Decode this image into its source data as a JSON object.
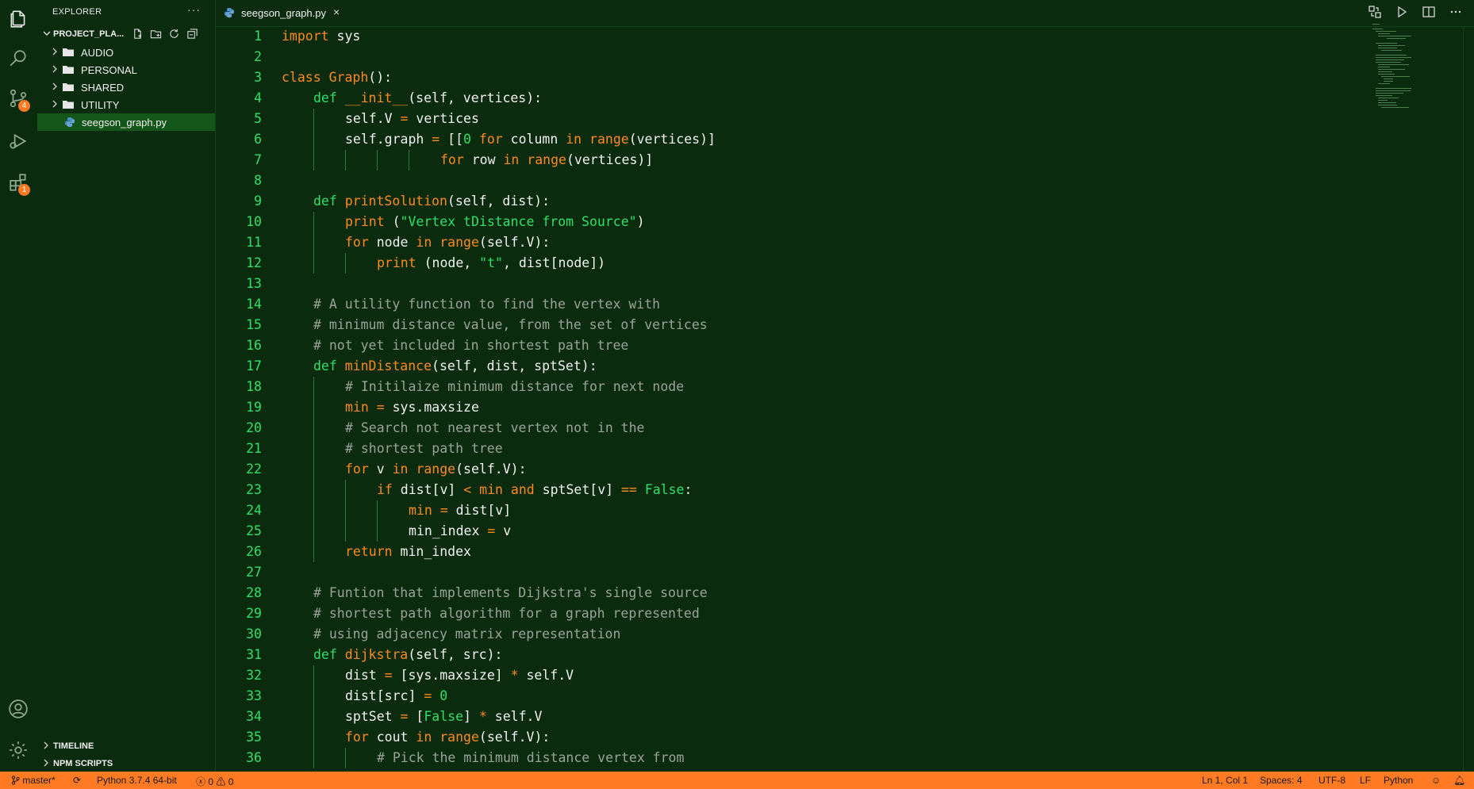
{
  "explorer": {
    "title": "EXPLORER",
    "more": "···",
    "project_name": "PROJECT_PLA...",
    "folders": [
      "AUDIO",
      "PERSONAL",
      "SHARED",
      "UTILITY"
    ],
    "file": "seegson_graph.py",
    "sections": [
      "TIMELINE",
      "NPM SCRIPTS"
    ]
  },
  "activity": {
    "source_control_badge": "4",
    "extensions_badge": "1",
    "icons": [
      "files-icon",
      "search-icon",
      "source-control-icon",
      "run-debug-icon",
      "extensions-icon",
      "account-icon",
      "settings-gear-icon"
    ]
  },
  "tab": {
    "name": "seegson_graph.py",
    "close": "×"
  },
  "editor": {
    "lines": [
      {
        "n": "1",
        "indent": 0,
        "t": [
          [
            "kw",
            "import"
          ],
          [
            "p",
            " sys"
          ]
        ]
      },
      {
        "n": "2",
        "indent": 0,
        "t": []
      },
      {
        "n": "3",
        "indent": 0,
        "t": [
          [
            "kw",
            "class"
          ],
          [
            "p",
            " "
          ],
          [
            "fn",
            "Graph"
          ],
          [
            "p",
            "():"
          ]
        ]
      },
      {
        "n": "4",
        "indent": 4,
        "t": [
          [
            "def",
            "def"
          ],
          [
            "p",
            " "
          ],
          [
            "fn",
            "__init__"
          ],
          [
            "p",
            "(self, vertices):"
          ]
        ]
      },
      {
        "n": "5",
        "indent": 8,
        "t": [
          [
            "p",
            "self.V "
          ],
          [
            "kw",
            "="
          ],
          [
            "p",
            " vertices"
          ]
        ]
      },
      {
        "n": "6",
        "indent": 8,
        "t": [
          [
            "p",
            "self.graph "
          ],
          [
            "kw",
            "="
          ],
          [
            "p",
            " [["
          ],
          [
            "num",
            "0"
          ],
          [
            "p",
            " "
          ],
          [
            "kw",
            "for"
          ],
          [
            "p",
            " column "
          ],
          [
            "kw",
            "in"
          ],
          [
            "p",
            " "
          ],
          [
            "fn",
            "range"
          ],
          [
            "p",
            "(vertices)]"
          ]
        ]
      },
      {
        "n": "7",
        "indent": 20,
        "t": [
          [
            "kw",
            "for"
          ],
          [
            "p",
            " row "
          ],
          [
            "kw",
            "in"
          ],
          [
            "p",
            " "
          ],
          [
            "fn",
            "range"
          ],
          [
            "p",
            "(vertices)]"
          ]
        ]
      },
      {
        "n": "8",
        "indent": 0,
        "t": []
      },
      {
        "n": "9",
        "indent": 4,
        "t": [
          [
            "def",
            "def"
          ],
          [
            "p",
            " "
          ],
          [
            "fn",
            "printSolution"
          ],
          [
            "p",
            "(self, dist):"
          ]
        ]
      },
      {
        "n": "10",
        "indent": 8,
        "t": [
          [
            "fn",
            "print"
          ],
          [
            "p",
            " ("
          ],
          [
            "str",
            "\"Vertex tDistance from Source\""
          ],
          [
            "p",
            ")"
          ]
        ]
      },
      {
        "n": "11",
        "indent": 8,
        "t": [
          [
            "kw",
            "for"
          ],
          [
            "p",
            " node "
          ],
          [
            "kw",
            "in"
          ],
          [
            "p",
            " "
          ],
          [
            "fn",
            "range"
          ],
          [
            "p",
            "(self.V):"
          ]
        ]
      },
      {
        "n": "12",
        "indent": 12,
        "t": [
          [
            "fn",
            "print"
          ],
          [
            "p",
            " (node, "
          ],
          [
            "str",
            "\"t\""
          ],
          [
            "p",
            ", dist[node])"
          ]
        ]
      },
      {
        "n": "13",
        "indent": 0,
        "t": []
      },
      {
        "n": "14",
        "indent": 4,
        "t": [
          [
            "cmt",
            "# A utility function to find the vertex with"
          ]
        ]
      },
      {
        "n": "15",
        "indent": 4,
        "t": [
          [
            "cmt",
            "# minimum distance value, from the set of vertices"
          ]
        ]
      },
      {
        "n": "16",
        "indent": 4,
        "t": [
          [
            "cmt",
            "# not yet included in shortest path tree"
          ]
        ]
      },
      {
        "n": "17",
        "indent": 4,
        "t": [
          [
            "def",
            "def"
          ],
          [
            "p",
            " "
          ],
          [
            "fn",
            "minDistance"
          ],
          [
            "p",
            "(self, dist, sptSet):"
          ]
        ]
      },
      {
        "n": "18",
        "indent": 8,
        "t": [
          [
            "cmt",
            "# Initilaize minimum distance for next node"
          ]
        ]
      },
      {
        "n": "19",
        "indent": 8,
        "t": [
          [
            "kw",
            "min"
          ],
          [
            "p",
            " "
          ],
          [
            "kw",
            "="
          ],
          [
            "p",
            " sys.maxsize"
          ]
        ]
      },
      {
        "n": "20",
        "indent": 8,
        "t": [
          [
            "cmt",
            "# Search not nearest vertex not in the"
          ]
        ]
      },
      {
        "n": "21",
        "indent": 8,
        "t": [
          [
            "cmt",
            "# shortest path tree"
          ]
        ]
      },
      {
        "n": "22",
        "indent": 8,
        "t": [
          [
            "kw",
            "for"
          ],
          [
            "p",
            " v "
          ],
          [
            "kw",
            "in"
          ],
          [
            "p",
            " "
          ],
          [
            "fn",
            "range"
          ],
          [
            "p",
            "(self.V):"
          ]
        ]
      },
      {
        "n": "23",
        "indent": 12,
        "t": [
          [
            "kw",
            "if"
          ],
          [
            "p",
            " dist[v] "
          ],
          [
            "kw",
            "<"
          ],
          [
            "p",
            " "
          ],
          [
            "kw",
            "min"
          ],
          [
            "p",
            " "
          ],
          [
            "kw",
            "and"
          ],
          [
            "p",
            " sptSet[v] "
          ],
          [
            "kw",
            "=="
          ],
          [
            "p",
            " "
          ],
          [
            "def",
            "False"
          ],
          [
            "p",
            ":"
          ]
        ]
      },
      {
        "n": "24",
        "indent": 16,
        "t": [
          [
            "kw",
            "min"
          ],
          [
            "p",
            " "
          ],
          [
            "kw",
            "="
          ],
          [
            "p",
            " dist[v]"
          ]
        ]
      },
      {
        "n": "25",
        "indent": 16,
        "t": [
          [
            "p",
            "min_index "
          ],
          [
            "kw",
            "="
          ],
          [
            "p",
            " v"
          ]
        ]
      },
      {
        "n": "26",
        "indent": 8,
        "t": [
          [
            "kw",
            "return"
          ],
          [
            "p",
            " min_index"
          ]
        ]
      },
      {
        "n": "27",
        "indent": 0,
        "t": []
      },
      {
        "n": "28",
        "indent": 4,
        "t": [
          [
            "cmt",
            "# Funtion that implements Dijkstra's single source"
          ]
        ]
      },
      {
        "n": "29",
        "indent": 4,
        "t": [
          [
            "cmt",
            "# shortest path algorithm for a graph represented"
          ]
        ]
      },
      {
        "n": "30",
        "indent": 4,
        "t": [
          [
            "cmt",
            "# using adjacency matrix representation"
          ]
        ]
      },
      {
        "n": "31",
        "indent": 4,
        "t": [
          [
            "def",
            "def"
          ],
          [
            "p",
            " "
          ],
          [
            "fn",
            "dijkstra"
          ],
          [
            "p",
            "(self, src):"
          ]
        ]
      },
      {
        "n": "32",
        "indent": 8,
        "t": [
          [
            "p",
            "dist "
          ],
          [
            "kw",
            "="
          ],
          [
            "p",
            " [sys.maxsize] "
          ],
          [
            "kw",
            "*"
          ],
          [
            "p",
            " self.V"
          ]
        ]
      },
      {
        "n": "33",
        "indent": 8,
        "t": [
          [
            "p",
            "dist[src] "
          ],
          [
            "kw",
            "="
          ],
          [
            "p",
            " "
          ],
          [
            "num",
            "0"
          ]
        ]
      },
      {
        "n": "34",
        "indent": 8,
        "t": [
          [
            "p",
            "sptSet "
          ],
          [
            "kw",
            "="
          ],
          [
            "p",
            " ["
          ],
          [
            "def",
            "False"
          ],
          [
            "p",
            "] "
          ],
          [
            "kw",
            "*"
          ],
          [
            "p",
            " self.V"
          ]
        ]
      },
      {
        "n": "35",
        "indent": 8,
        "t": [
          [
            "kw",
            "for"
          ],
          [
            "p",
            " cout "
          ],
          [
            "kw",
            "in"
          ],
          [
            "p",
            " "
          ],
          [
            "fn",
            "range"
          ],
          [
            "p",
            "(self.V):"
          ]
        ]
      },
      {
        "n": "36",
        "indent": 12,
        "t": [
          [
            "cmt",
            "# Pick the minimum distance vertex from"
          ]
        ]
      }
    ]
  },
  "status": {
    "branch": "master*",
    "python": "Python 3.7.4 64-bit",
    "errors": "0",
    "warnings": "0",
    "position": "Ln 1, Col 1",
    "spaces": "Spaces: 4",
    "encoding": "UTF-8",
    "eol": "LF",
    "language": "Python"
  }
}
